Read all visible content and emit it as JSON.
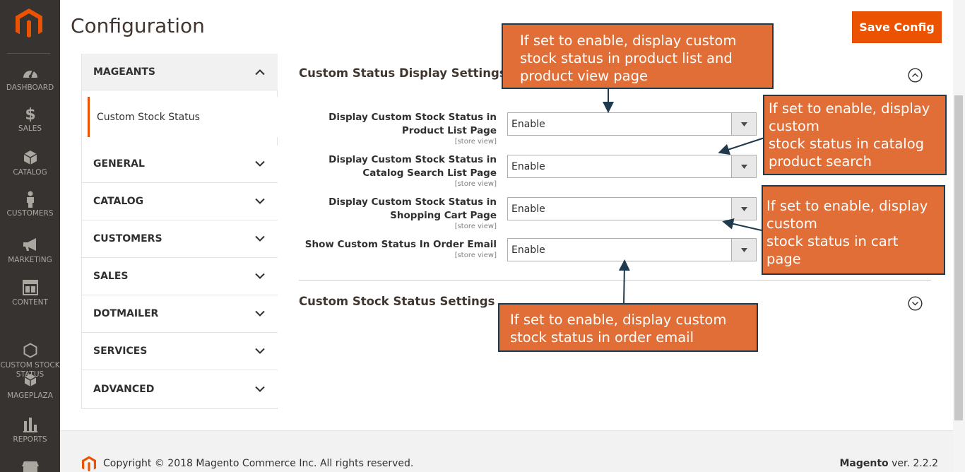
{
  "header": {
    "title": "Configuration",
    "save_label": "Save Config"
  },
  "sidebar": {
    "items": [
      {
        "label": "DASHBOARD",
        "icon": "dashboard-icon"
      },
      {
        "label": "SALES",
        "icon": "dollar-icon"
      },
      {
        "label": "CATALOG",
        "icon": "box-icon"
      },
      {
        "label": "CUSTOMERS",
        "icon": "person-icon"
      },
      {
        "label": "MARKETING",
        "icon": "megaphone-icon"
      },
      {
        "label": "CONTENT",
        "icon": "layout-icon"
      },
      {
        "label": "CUSTOM STOCK\nSTATUS",
        "icon": "hexagon-icon"
      },
      {
        "label": "MAGEPLAZA",
        "icon": "cube-icon"
      },
      {
        "label": "REPORTS",
        "icon": "bar-chart-icon"
      }
    ]
  },
  "tabs": {
    "open": {
      "label": "MAGEANTS",
      "sub_item": "Custom Stock Status"
    },
    "items": [
      "GENERAL",
      "CATALOG",
      "CUSTOMERS",
      "SALES",
      "DOTMAILER",
      "SERVICES",
      "ADVANCED"
    ]
  },
  "sections": {
    "display": {
      "title": "Custom Status Display Settings",
      "rows": [
        {
          "label": "Display Custom Stock Status in Product List Page",
          "scope": "[store view]",
          "value": "Enable"
        },
        {
          "label": "Display Custom Stock Status in Catalog Search List Page",
          "scope": "[store view]",
          "value": "Enable"
        },
        {
          "label": "Display Custom Stock Status in Shopping Cart Page",
          "scope": "[store view]",
          "value": "Enable"
        },
        {
          "label": "Show Custom Status In Order Email",
          "scope": "[store view]",
          "value": "Enable"
        }
      ]
    },
    "stock": {
      "title": "Custom Stock Status Settings"
    }
  },
  "callouts": {
    "c1": "If set to enable, display custom\nstock status in product list and\nproduct view page",
    "c2": "If set to enable, display\ncustom\nstock status in catalog\nproduct search",
    "c3": "If set to enable, display\ncustom\nstock status in cart\npage",
    "c4": "If set to enable, display custom\nstock status in order email"
  },
  "footer": {
    "copyright": "Copyright © 2018 Magento Commerce Inc. All rights reserved.",
    "brand": "Magento",
    "version": " ver. 2.2.2"
  },
  "colors": {
    "accent": "#eb5202",
    "sidebar": "#373330",
    "callout": "#e06e36",
    "callout_border": "#1f3a4c"
  }
}
